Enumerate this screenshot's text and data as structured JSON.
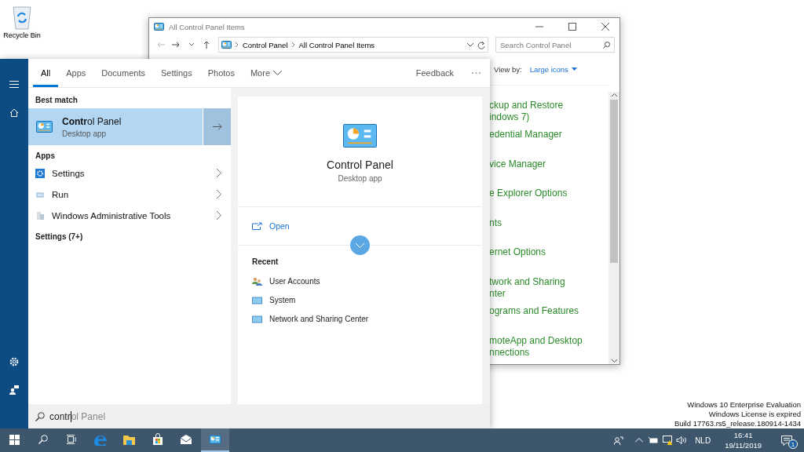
{
  "desktop": {
    "icons": [
      {
        "label": "Recycle Bin"
      }
    ],
    "activation_notice": [
      "Windows 10 Enterprise Evaluation",
      "Windows License is expired",
      "Build 17763.rs5_release.180914-1434"
    ]
  },
  "window": {
    "title": "All Control Panel Items",
    "address": {
      "crumbs": [
        "Control Panel",
        "All Control Panel Items"
      ]
    },
    "search": {
      "placeholder": "Search Control Panel"
    },
    "view_by": {
      "label": "View by:",
      "value": "Large icons"
    },
    "items": [
      {
        "lines": [
          "ckup and Restore",
          "indows 7)"
        ]
      },
      {
        "lines": [
          "edential Manager"
        ]
      },
      {
        "lines": [
          "vice Manager"
        ]
      },
      {
        "lines": [
          "e Explorer Options"
        ]
      },
      {
        "lines": [
          "nts"
        ]
      },
      {
        "lines": [
          "ernet Options"
        ]
      },
      {
        "lines": [
          "twork and Sharing",
          "nter"
        ]
      },
      {
        "lines": [
          "ograms and Features"
        ]
      },
      {
        "lines": [
          "moteApp and Desktop",
          "nnections"
        ]
      }
    ]
  },
  "start_menu": {
    "tabs": [
      {
        "label": "All",
        "selected": true,
        "kind": "plain"
      },
      {
        "label": "Apps",
        "selected": false,
        "kind": "plain"
      },
      {
        "label": "Documents",
        "selected": false,
        "kind": "plain"
      },
      {
        "label": "Settings",
        "selected": false,
        "kind": "plain"
      },
      {
        "label": "Photos",
        "selected": false,
        "kind": "plain"
      },
      {
        "label": "More",
        "selected": false,
        "kind": "dropdown"
      }
    ],
    "feedback": "Feedback",
    "best_match": {
      "heading": "Best match",
      "title": "**Contr**ol Panel",
      "subtitle": "Desktop app",
      "selected": true
    },
    "apps": {
      "heading": "Apps",
      "items": [
        {
          "label": "Settings"
        },
        {
          "label": "Run"
        },
        {
          "label": "Windows Administrative Tools"
        }
      ]
    },
    "settings_heading": "Settings (7+)",
    "preview": {
      "title": "Control Panel",
      "subtitle": "Desktop app",
      "action": "Open",
      "recent_heading": "Recent",
      "recent": [
        {
          "label": "User Accounts"
        },
        {
          "label": "System"
        },
        {
          "label": "Network and Sharing Center"
        }
      ]
    },
    "search": {
      "value": "contr",
      "suggestion": "ol Panel"
    }
  },
  "taskbar": {
    "apps": [
      {
        "active": false
      },
      {
        "active": false
      },
      {
        "active": false
      },
      {
        "active": false
      },
      {
        "active": true
      }
    ],
    "language": "NLD",
    "time": "16:41",
    "date": "19/11/2019",
    "notifications": "1"
  }
}
